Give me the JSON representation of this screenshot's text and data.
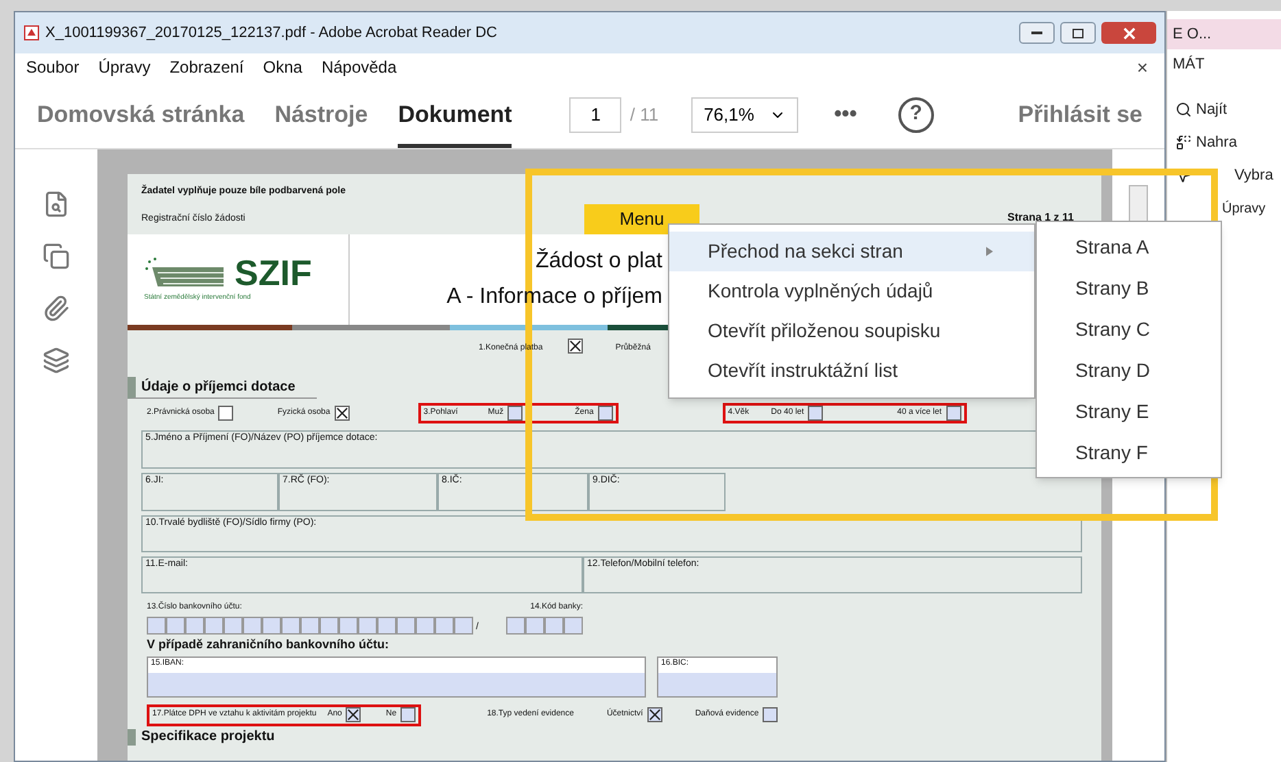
{
  "window": {
    "title": "X_1001199367_20170125_122137.pdf - Adobe Acrobat Reader DC",
    "close_doc": "×"
  },
  "menu_bar": [
    "Soubor",
    "Úpravy",
    "Zobrazení",
    "Okna",
    "Nápověda"
  ],
  "tabs": [
    {
      "label": "Domovská stránka",
      "selected": false
    },
    {
      "label": "Nástroje",
      "selected": false
    },
    {
      "label": "Dokument",
      "selected": true
    }
  ],
  "toolbar": {
    "page": "1",
    "page_total": "/ 11",
    "zoom": "76,1%",
    "more": "•••",
    "help": "?",
    "sign_in": "Přihlásit se"
  },
  "document": {
    "note": "Žadatel vyplňuje pouze bíle podbarvená pole",
    "menu_button": "Menu",
    "page_label": "Strana 1 z 11",
    "reg_label": "Registrační číslo žádosti",
    "logo": {
      "mark": "SZIF",
      "subtitle": "Státní zemědělský intervenční fond"
    },
    "title": "Žádost o plat",
    "subtitle": "A - Informace o příjem",
    "payment": {
      "label": "1.Konečná platba",
      "checked": true
    },
    "payment_other": "Průběžná",
    "section": "Údaje o příjemci dotace",
    "person": [
      {
        "label": "2.Právnická osoba",
        "checked": false
      },
      {
        "label": "Fyzická osoba",
        "checked": true
      }
    ],
    "gender": {
      "label": "3.Pohlaví",
      "options": [
        {
          "label": "Muž",
          "checked": false
        },
        {
          "label": "Žena",
          "checked": false
        }
      ]
    },
    "age": {
      "label": "4.Věk",
      "options": [
        {
          "label": "Do 40 let",
          "checked": false
        },
        {
          "label": "40 a více let",
          "checked": false
        }
      ]
    },
    "name_field": "5.Jméno a Příjmení (FO)/Název (PO) příjemce dotace:",
    "id_fields": [
      "6.JI:",
      "7.RČ (FO):",
      "8.IČ:",
      "9.DIČ:"
    ],
    "address_field": "10.Trvalé bydliště (FO)/Sídlo firmy (PO):",
    "email_field": "11.E-mail:",
    "phone_field": "12.Telefon/Mobilní telefon:",
    "account": {
      "label": "13.Číslo bankovního účtu:",
      "separator": "/",
      "bank_label": "14.Kód banky:"
    },
    "foreign_heading": "V případě zahraničního bankovního účtu:",
    "iban_field": "15.IBAN:",
    "bic_field": "16.BIC:",
    "vat": {
      "label": "17.Plátce DPH ve vztahu k aktivitám projektu",
      "options": [
        {
          "label": "Ano",
          "checked": true
        },
        {
          "label": "Ne",
          "checked": false
        }
      ]
    },
    "records": {
      "label": "18.Typ vedení evidence",
      "options": [
        {
          "label": "Účetnictví",
          "checked": true
        },
        {
          "label": "Daňová evidence",
          "checked": false
        }
      ]
    },
    "next_section": "Specifikace projektu"
  },
  "context_menu": {
    "items": [
      {
        "label": "Přechod na sekci stran",
        "selected": true,
        "submenu": true
      },
      {
        "label": "Kontrola vyplněných údajů",
        "selected": false,
        "submenu": false
      },
      {
        "label": "Otevřít přiloženou soupisku",
        "selected": false,
        "submenu": false
      },
      {
        "label": "Otevřít instruktážní list",
        "selected": false,
        "submenu": false
      }
    ],
    "submenu": [
      "Strana A",
      "Strany B",
      "Strany C",
      "Strany D",
      "Strany E",
      "Strany F"
    ]
  },
  "other_window": {
    "tab": "E O...",
    "ribbon": "MÁT",
    "commands": [
      "Najít",
      "Nahra",
      "Vybra",
      "Úpravy"
    ]
  }
}
